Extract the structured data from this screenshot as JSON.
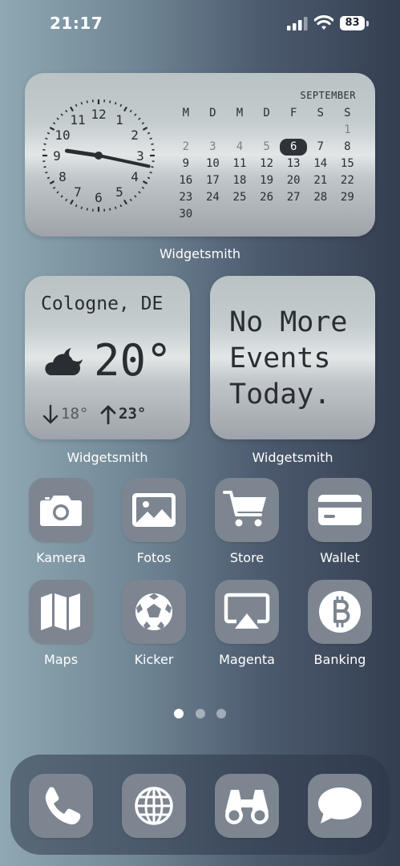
{
  "status_bar": {
    "time": "21:17",
    "battery": "83"
  },
  "calendar_widget": {
    "month": "SEPTEMBER",
    "weekdays": [
      "M",
      "D",
      "M",
      "D",
      "F",
      "S",
      "S"
    ],
    "days": [
      {
        "d": "",
        "dim": false
      },
      {
        "d": "",
        "dim": false
      },
      {
        "d": "",
        "dim": false
      },
      {
        "d": "",
        "dim": false
      },
      {
        "d": "",
        "dim": false
      },
      {
        "d": "",
        "dim": false
      },
      {
        "d": "1",
        "dim": true
      },
      {
        "d": "2",
        "dim": true
      },
      {
        "d": "3",
        "dim": true
      },
      {
        "d": "4",
        "dim": true
      },
      {
        "d": "5",
        "dim": true
      },
      {
        "d": "6",
        "today": true
      },
      {
        "d": "7"
      },
      {
        "d": "8"
      },
      {
        "d": "9"
      },
      {
        "d": "10"
      },
      {
        "d": "11"
      },
      {
        "d": "12"
      },
      {
        "d": "13"
      },
      {
        "d": "14"
      },
      {
        "d": "15"
      },
      {
        "d": "16"
      },
      {
        "d": "17"
      },
      {
        "d": "18"
      },
      {
        "d": "19"
      },
      {
        "d": "20"
      },
      {
        "d": "21"
      },
      {
        "d": "22"
      },
      {
        "d": "23"
      },
      {
        "d": "24"
      },
      {
        "d": "25"
      },
      {
        "d": "26"
      },
      {
        "d": "27"
      },
      {
        "d": "28"
      },
      {
        "d": "29"
      },
      {
        "d": "30"
      }
    ],
    "clock_numbers": [
      "12",
      "1",
      "2",
      "3",
      "4",
      "5",
      "6",
      "7",
      "8",
      "9",
      "10",
      "11"
    ],
    "clock_time": {
      "hour": 21,
      "minute": 17
    },
    "label": "Widgetsmith"
  },
  "weather_widget": {
    "city": "Cologne, DE",
    "temperature": "20°",
    "low": "18°",
    "high": "23°",
    "icon": "cloud-moon-icon",
    "label": "Widgetsmith"
  },
  "events_widget": {
    "lines": [
      "No More",
      "Events",
      "Today."
    ],
    "label": "Widgetsmith"
  },
  "apps": [
    {
      "label": "Kamera",
      "icon": "camera-icon"
    },
    {
      "label": "Fotos",
      "icon": "photo-icon"
    },
    {
      "label": "Store",
      "icon": "cart-icon"
    },
    {
      "label": "Wallet",
      "icon": "wallet-card-icon"
    },
    {
      "label": "Maps",
      "icon": "map-icon"
    },
    {
      "label": "Kicker",
      "icon": "soccer-ball-icon"
    },
    {
      "label": "Magenta",
      "icon": "airplay-icon"
    },
    {
      "label": "Banking",
      "icon": "bitcoin-icon"
    }
  ],
  "page_dots": {
    "count": 3,
    "active": 0
  },
  "dock": [
    {
      "icon": "phone-icon"
    },
    {
      "icon": "globe-icon"
    },
    {
      "icon": "binoculars-icon"
    },
    {
      "icon": "message-bubble-icon"
    }
  ],
  "colors": {
    "icon_tile": "#7c8590",
    "icon_glyph": "#ffffff",
    "today_marker": "#2f3338"
  }
}
